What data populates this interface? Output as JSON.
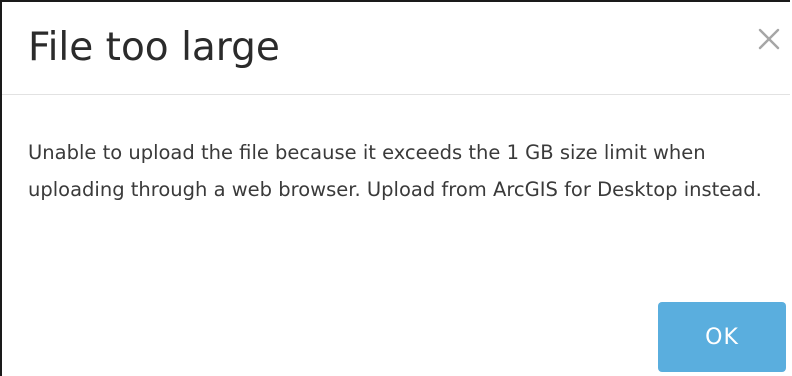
{
  "dialog": {
    "title": "File too large",
    "close_icon": "close-icon",
    "message": "Unable to upload the file because it exceeds the 1 GB size limit when uploading through a web browser. Upload from ArcGIS for Desktop instead.",
    "ok_label": "OK"
  },
  "colors": {
    "ok_button": "#5aaede",
    "title_text": "#2b2b2b",
    "body_text": "#3a3a3a",
    "close_icon": "#a6a6a6"
  }
}
